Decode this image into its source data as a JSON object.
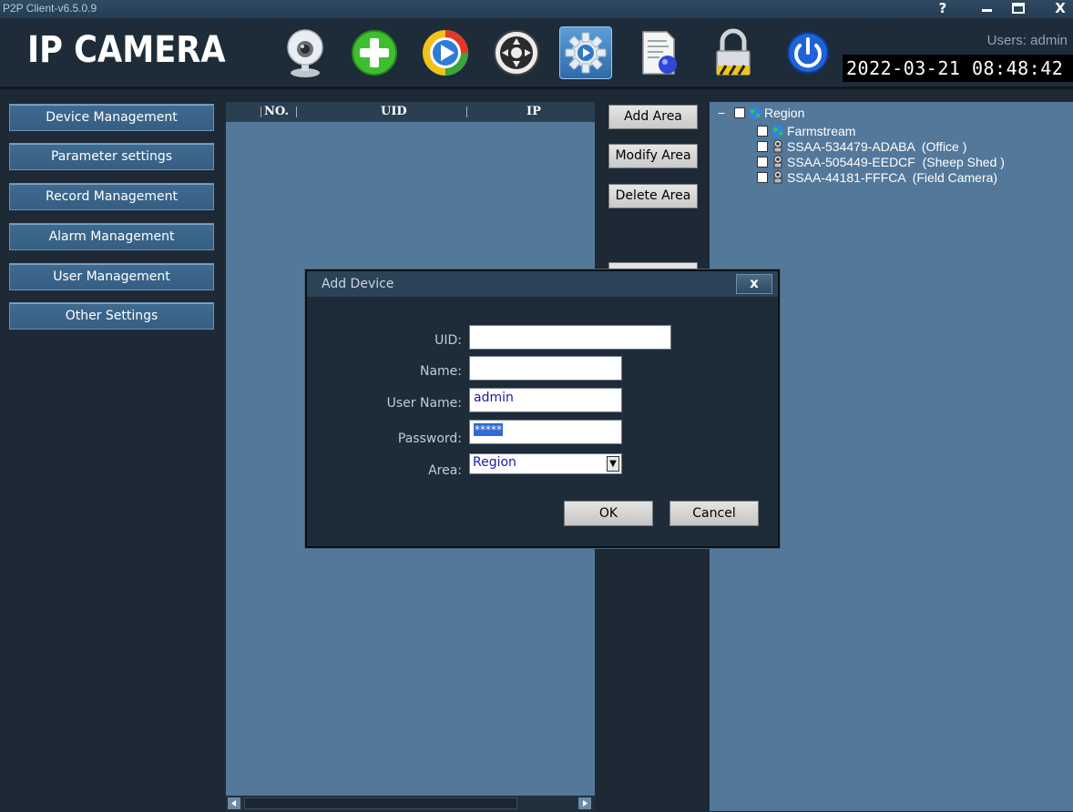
{
  "window": {
    "title": "P2P Client-v6.5.0.9",
    "controls": [
      "?",
      "‒",
      "□",
      "X"
    ]
  },
  "header": {
    "logo": "IP CAMERA",
    "users_label": "Users: admin",
    "datetime": "2022-03-21  08:48:42",
    "toolbar": [
      "webcam-icon",
      "add-device-icon",
      "playback-icon",
      "ptz-control-icon",
      "settings-icon",
      "log-icon",
      "lock-icon",
      "power-icon"
    ],
    "active_tool": "settings-icon"
  },
  "menu": {
    "items": [
      {
        "label": "Device Management"
      },
      {
        "label": "Parameter settings"
      },
      {
        "label": "Record Management"
      },
      {
        "label": "Alarm Management"
      },
      {
        "label": "User Management"
      },
      {
        "label": "Other Settings"
      }
    ]
  },
  "device_list": {
    "columns": [
      "NO.",
      "UID",
      "IP"
    ],
    "rows": []
  },
  "area_buttons": {
    "add": "Add Area",
    "modify": "Modify Area",
    "delete": "Delete Area"
  },
  "tree": {
    "root": "Region",
    "root_expander": "−",
    "children": [
      {
        "label": "Farmstream",
        "type": "area"
      },
      {
        "label": "SSAA-534479-ADABA  (Office )",
        "type": "camera"
      },
      {
        "label": "SSAA-505449-EEDCF  (Sheep Shed )",
        "type": "camera"
      },
      {
        "label": "SSAA-44181-FFFCA  (Field Camera)",
        "type": "camera"
      }
    ]
  },
  "dialog": {
    "title": "Add Device",
    "close": "x",
    "fields": {
      "uid_label": "UID:",
      "uid_value": "",
      "name_label": "Name:",
      "name_value": "",
      "username_label": "User Name:",
      "username_value": "admin",
      "password_label": "Password:",
      "password_value": "*****",
      "area_label": "Area:",
      "area_value": "Region"
    },
    "ok": "OK",
    "cancel": "Cancel"
  }
}
